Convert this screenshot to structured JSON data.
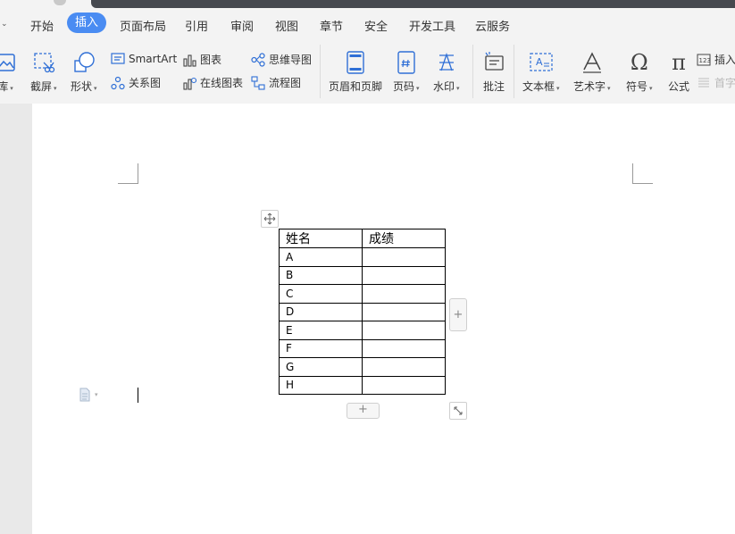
{
  "menubar": {
    "items": [
      "开始",
      "插入",
      "页面布局",
      "引用",
      "审阅",
      "视图",
      "章节",
      "安全",
      "开发工具",
      "云服务"
    ],
    "active": "插入"
  },
  "ribbon": {
    "gallery_label": "库",
    "screenshot_label": "截屏",
    "shape_label": "形状",
    "smartart_label": "SmartArt",
    "relation_label": "关系图",
    "chart_label": "图表",
    "online_chart_label": "在线图表",
    "mindmap_label": "思维导图",
    "flowchart_label": "流程图",
    "header_footer_label": "页眉和页脚",
    "page_number_label": "页码",
    "watermark_label": "水印",
    "comment_label": "批注",
    "textbox_label": "文本框",
    "wordart_label": "艺术字",
    "symbol_label": "符号",
    "formula_label": "公式",
    "insert_number_label": "插入",
    "dropcap_label": "首字"
  },
  "table": {
    "header": [
      "姓名",
      "成绩"
    ],
    "rows": [
      [
        "A",
        ""
      ],
      [
        "B",
        ""
      ],
      [
        "C",
        ""
      ],
      [
        "D",
        ""
      ],
      [
        "E",
        ""
      ],
      [
        "F",
        ""
      ],
      [
        "G",
        ""
      ],
      [
        "H",
        ""
      ]
    ]
  },
  "controls": {
    "add_symbol": "+"
  },
  "colors": {
    "accent": "#4a8cf2",
    "icon_blue": "#2f6fd6",
    "titlebar": "#46494f"
  }
}
